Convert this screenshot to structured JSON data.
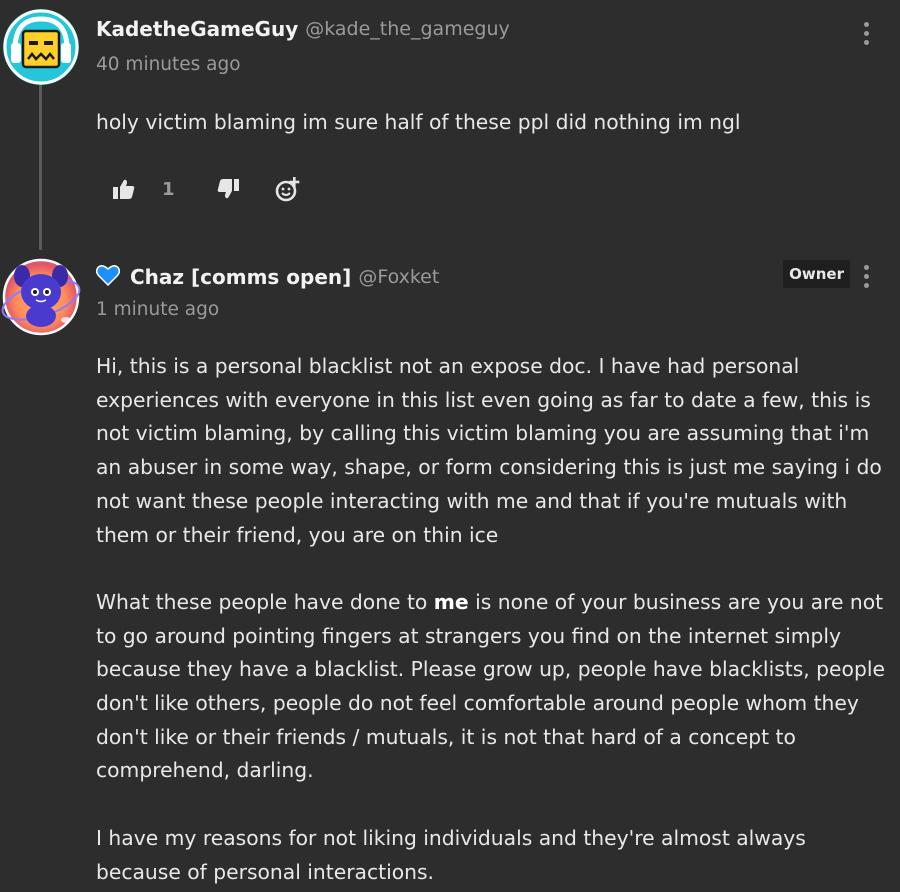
{
  "comments": [
    {
      "username": "KadetheGameGuy",
      "handle": "@kade_the_gameguy",
      "time": "40 minutes ago",
      "body": [
        "holy victim blaming im sure half of these ppl did nothing im ngl"
      ],
      "like_count": "1",
      "avatar": "gameguy-avatar",
      "icons": [
        "thumbs-up-icon",
        "thumbs-down-icon",
        "add-reaction-icon",
        "more-options-icon"
      ]
    },
    {
      "username": "Chaz [comms open]",
      "handle": "@Foxket",
      "time": "1 minute ago",
      "badge": "Owner",
      "name_icon": "blue-heart-icon",
      "avatar": "purple-creature-avatar",
      "body_p1": "Hi, this is a personal blacklist not an expose doc. I have had personal experiences with everyone in this list even going as far to date a few, this is not victim blaming, by calling this victim blaming you are assuming that i'm an abuser in some way, shape, or form considering this is just me saying i do not want these people interacting with me and that if you're mutuals with them or their friend, you are on thin ice",
      "body_p2_before": "What these people have done to ",
      "body_p2_bold": "me",
      "body_p2_after": " is none of your business are you are not to go around pointing fingers at strangers you find on the internet simply because they have a blacklist. Please grow up, people have blacklists, people don't like others, people do not feel comfortable around people whom they don't like or their friends / mutuals, it is not that hard of a concept to comprehend, darling.",
      "body_p3": "I have my reasons for not liking individuals and they're almost always because of personal interactions."
    }
  ],
  "colors": {
    "background": "#2d2d2d",
    "text": "#e8e8e8",
    "muted": "#9a9a9a",
    "badge_bg": "#1f1f1f",
    "heart": "#1e8fff",
    "avatar1_bg": "#26c6da",
    "avatar1_face": "#ffcf2a"
  }
}
